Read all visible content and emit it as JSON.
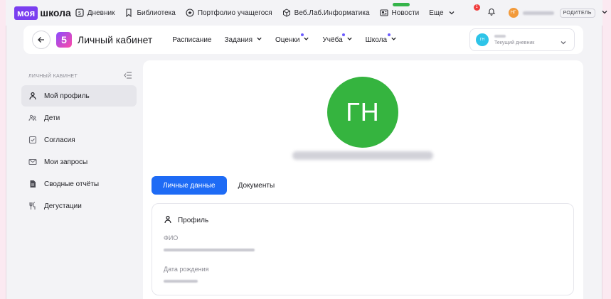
{
  "topnav": {
    "logo_moya": "моя",
    "logo_shkola": "школа",
    "items": [
      {
        "label": "Дневник",
        "icon": "diary-icon"
      },
      {
        "label": "Библиотека",
        "icon": "bookmark-icon"
      },
      {
        "label": "Портфолио учащегося",
        "icon": "star-badge-icon"
      },
      {
        "label": "Веб.Лаб.Информатика",
        "icon": "cube-icon"
      },
      {
        "label": "Новости",
        "icon": "news-icon"
      },
      {
        "label": "Еще",
        "icon": "chevron-down-icon"
      }
    ],
    "notification_count": "1",
    "user_initials": "НГ",
    "role": "РОДИТЕЛЬ"
  },
  "header": {
    "logo_digit": "5",
    "title": "Личный кабинет",
    "nav": [
      {
        "label": "Расписание",
        "has_dropdown": false,
        "has_dot": false
      },
      {
        "label": "Задания",
        "has_dropdown": true,
        "has_dot": false
      },
      {
        "label": "Оценки",
        "has_dropdown": true,
        "has_dot": true
      },
      {
        "label": "Учёба",
        "has_dropdown": true,
        "has_dot": true
      },
      {
        "label": "Школа",
        "has_dropdown": true,
        "has_dot": true
      }
    ],
    "diary": {
      "initials": "ГН",
      "subtitle": "Текущий дневник"
    }
  },
  "sidebar": {
    "title": "ЛИЧНЫЙ КАБИНЕТ",
    "items": [
      {
        "label": "Мой профиль",
        "icon": "person-icon",
        "active": true
      },
      {
        "label": "Дети",
        "icon": "children-icon",
        "active": false
      },
      {
        "label": "Согласия",
        "icon": "checkbox-icon",
        "active": false
      },
      {
        "label": "Мои запросы",
        "icon": "mail-icon",
        "active": false
      },
      {
        "label": "Сводные отчёты",
        "icon": "report-icon",
        "active": false
      },
      {
        "label": "Дегустации",
        "icon": "cutlery-icon",
        "active": false
      }
    ]
  },
  "profile": {
    "initials": "ГН",
    "tabs": [
      "Личные данные",
      "Документы"
    ],
    "card_title": "Профиль",
    "fields": [
      {
        "label": "ФИО"
      },
      {
        "label": "Дата рождения"
      }
    ]
  },
  "colors": {
    "accent": "#1e6bf5",
    "avatar_green": "#35b43f",
    "brand_purple": "#7a3ef0"
  }
}
